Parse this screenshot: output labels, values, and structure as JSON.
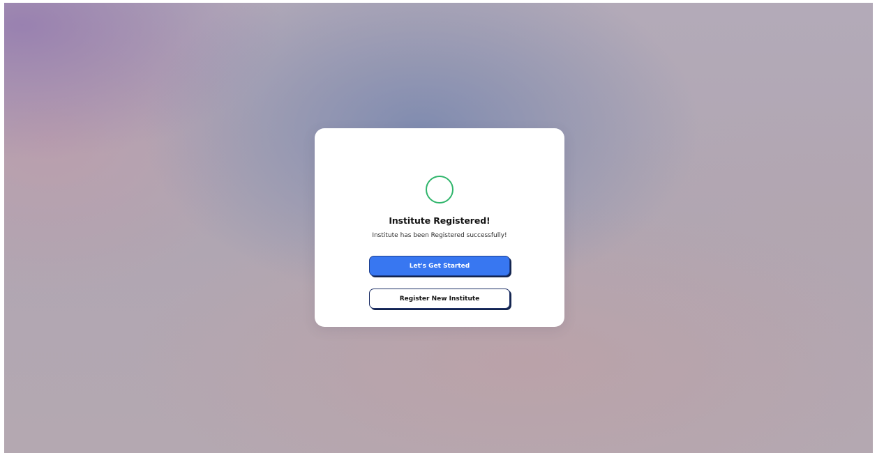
{
  "dialog": {
    "title": "Institute Registered!",
    "message": "Institute has been Registered successfully!",
    "status_icon": "success-ring-icon",
    "status_color": "#2fb56b"
  },
  "actions": {
    "primary_label": "Let's Get Started",
    "secondary_label": "Register New Institute"
  },
  "colors": {
    "primary_button": "#3877f1",
    "button_shadow": "#14254f"
  }
}
